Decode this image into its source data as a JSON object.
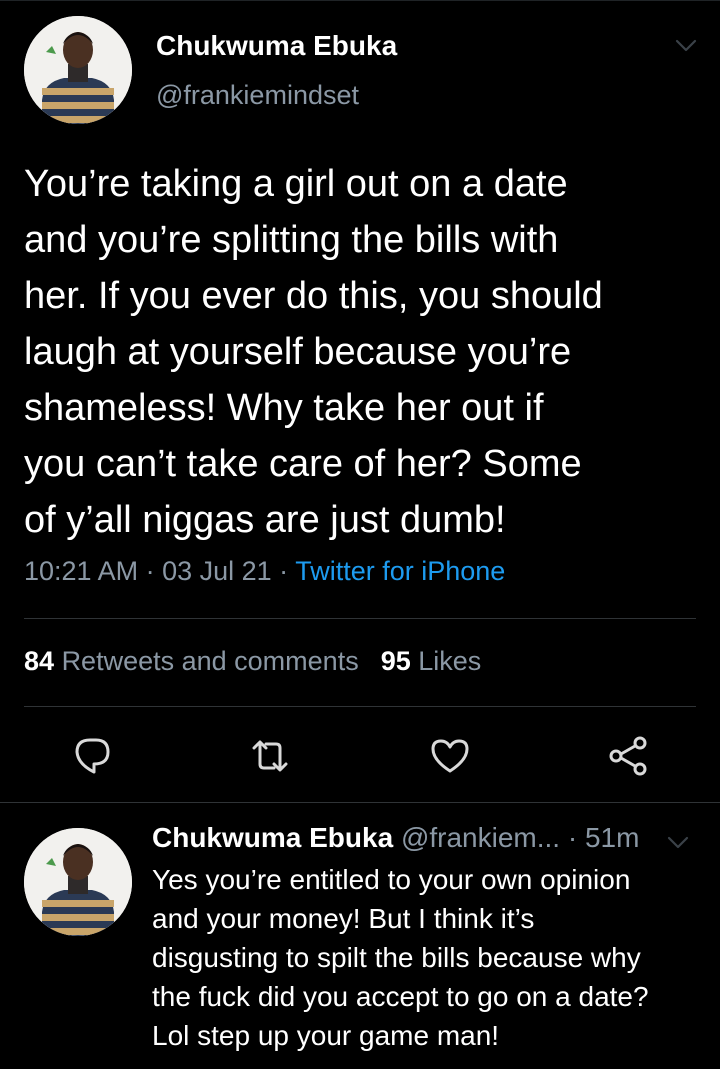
{
  "tweet": {
    "author_name": "Chukwuma Ebuka",
    "author_handle": "@frankiemindset",
    "text": "You’re taking a girl out on a date\nand you’re splitting the bills with\nher. If you ever do this, you should\nlaugh at yourself because you’re\nshameless! Why take her out if\nyou can’t take care of her? Some\nof y’all niggas are just dumb!",
    "time": "10:21 AM",
    "date": "03 Jul 21",
    "separator": " · ",
    "source": "Twitter for iPhone",
    "retweets_count": "84",
    "retweets_label": "Retweets and comments",
    "likes_count": "95",
    "likes_label": "Likes"
  },
  "actions": [
    {
      "icon": "reply-icon"
    },
    {
      "icon": "retweet-icon"
    },
    {
      "icon": "like-icon"
    },
    {
      "icon": "share-icon"
    }
  ],
  "reply": {
    "author_name": "Chukwuma Ebuka",
    "author_handle": "@frankiem...",
    "time_sep": " · ",
    "time_ago": "51m",
    "text": "Yes you’re entitled to your own opinion\nand your money! But I think it’s\ndisgusting to spilt the bills because why\nthe fuck did you accept to go on a date?\nLol step up your game man!"
  },
  "colors": {
    "background": "#000000",
    "text": "#ffffff",
    "secondary": "#8b98a5",
    "accent": "#1d9bf0",
    "divider": "#2f3336"
  }
}
